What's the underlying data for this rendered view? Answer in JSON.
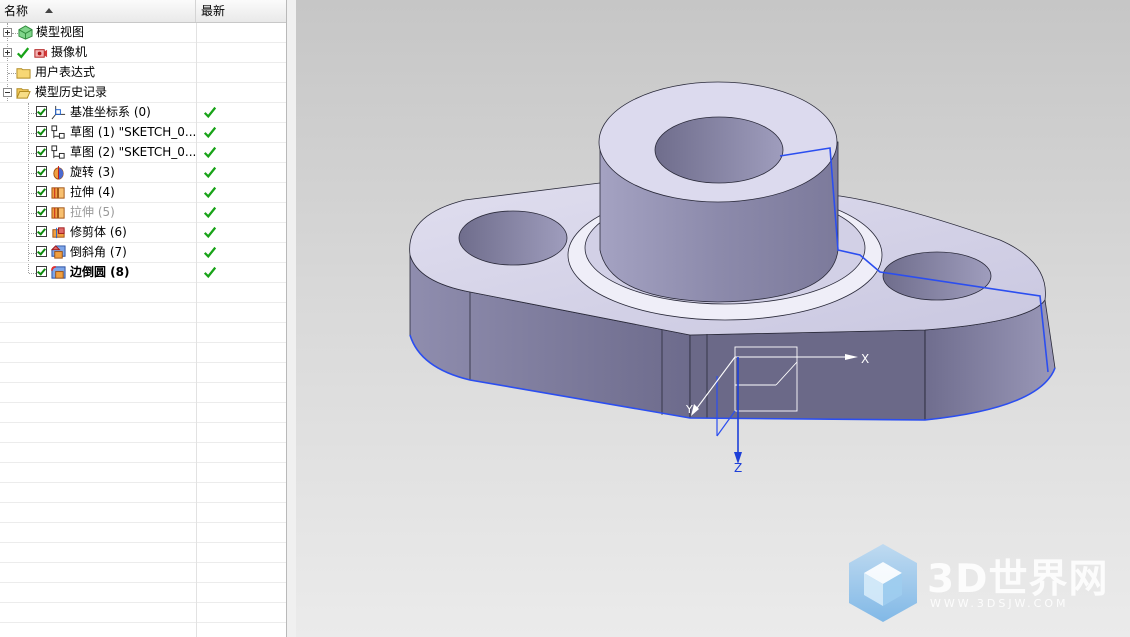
{
  "navigator": {
    "headers": {
      "name": "名称",
      "latest": "最新"
    },
    "items": [
      {
        "label": "模型视图",
        "icon": "model-views-icon",
        "expander": "plus"
      },
      {
        "label": "摄像机",
        "icon": "camera-icon",
        "expander": "plus"
      },
      {
        "label": "用户表达式",
        "icon": "folder-icon",
        "expander": ""
      },
      {
        "label": "模型历史记录",
        "icon": "folder-open-icon",
        "expander": "minus"
      },
      {
        "label": "基准坐标系 (0)",
        "icon": "datum-csys-icon",
        "latest": true,
        "style": "normal"
      },
      {
        "label": "草图 (1) \"SKETCH_0...",
        "icon": "sketch-icon",
        "latest": true,
        "style": "normal"
      },
      {
        "label": "草图 (2) \"SKETCH_0...",
        "icon": "sketch-icon",
        "latest": true,
        "style": "normal"
      },
      {
        "label": "旋转 (3)",
        "icon": "revolve-icon",
        "latest": true,
        "style": "normal"
      },
      {
        "label": "拉伸 (4)",
        "icon": "extrude-icon",
        "latest": true,
        "style": "normal"
      },
      {
        "label": "拉伸 (5)",
        "icon": "extrude-icon",
        "latest": true,
        "style": "gray"
      },
      {
        "label": "修剪体 (6)",
        "icon": "trim-body-icon",
        "latest": true,
        "style": "normal"
      },
      {
        "label": "倒斜角 (7)",
        "icon": "chamfer-icon",
        "latest": true,
        "style": "normal"
      },
      {
        "label": "边倒圆 (8)",
        "icon": "edge-blend-icon",
        "latest": true,
        "style": "bold"
      }
    ]
  },
  "viewport": {
    "axes": {
      "x": "X",
      "y": "Y",
      "z": "Z"
    },
    "watermark": {
      "title": "3D世界网",
      "url": "WWW.3DSJW.COM"
    },
    "colors": {
      "body": "#a8a6c6",
      "edge_highlight": "#2b4ef0",
      "background_top": "#c6c6c6",
      "background_bottom": "#ebebeb"
    }
  }
}
